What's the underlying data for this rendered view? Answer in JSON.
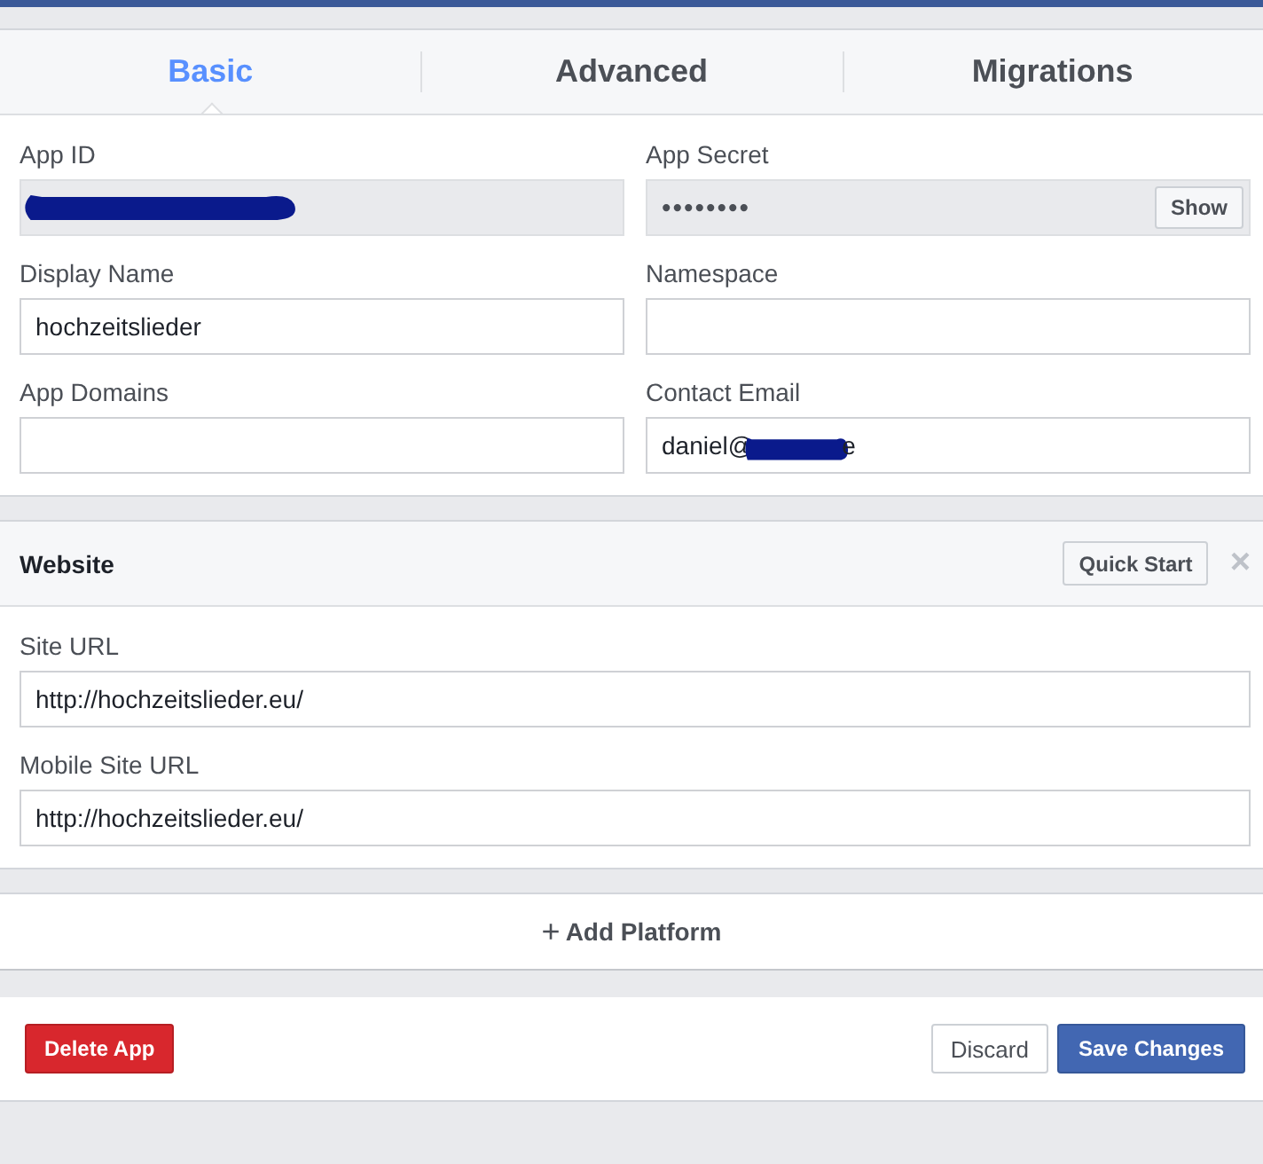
{
  "tabs": [
    {
      "label": "Basic",
      "selected": true
    },
    {
      "label": "Advanced",
      "selected": false
    },
    {
      "label": "Migrations",
      "selected": false
    }
  ],
  "basic_fields": [
    {
      "label": "App ID",
      "kind": "readonly",
      "redacted": true
    },
    {
      "label": "App Secret",
      "kind": "secret",
      "value": "••••••••",
      "button": "Show"
    },
    {
      "label": "Display Name",
      "kind": "text",
      "value": "hochzeitslieder"
    },
    {
      "label": "Namespace",
      "kind": "text"
    },
    {
      "label": "App Domains",
      "kind": "text"
    },
    {
      "label": "Contact Email",
      "kind": "text",
      "value": "daniel@",
      "redacted": true,
      "value_after": "e"
    }
  ],
  "platform": {
    "title": "Website",
    "button": "Quick Start",
    "close": "×",
    "fields": [
      {
        "label": "Site URL",
        "value": "http://hochzeitslieder.eu/"
      },
      {
        "label": "Mobile Site URL",
        "value": "http://hochzeitslieder.eu/"
      }
    ]
  },
  "add_platform": {
    "icon": "+",
    "label": "Add Platform"
  },
  "footer": {
    "delete": "Delete App",
    "discard": "Discard",
    "save": "Save Changes"
  }
}
